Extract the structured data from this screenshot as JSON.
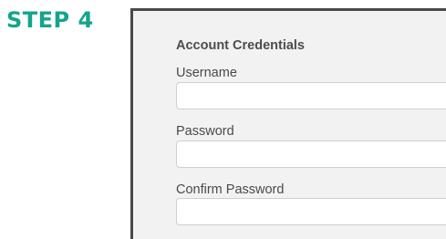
{
  "step": {
    "title": "STEP 4",
    "accent_color": "#13a58a"
  },
  "form": {
    "section_title": "Account Credentials",
    "fields": [
      {
        "label": "Username",
        "value": "",
        "placeholder": ""
      },
      {
        "label": "Password",
        "value": "",
        "placeholder": ""
      },
      {
        "label": "Confirm Password",
        "value": "",
        "placeholder": ""
      }
    ]
  }
}
